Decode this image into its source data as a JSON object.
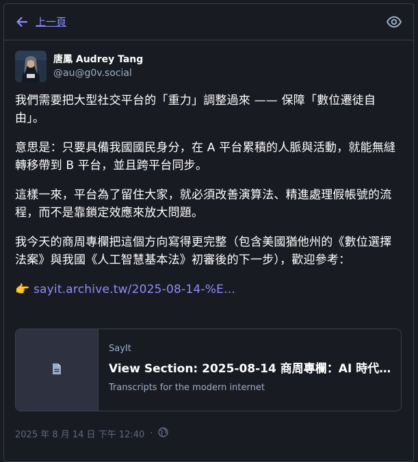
{
  "header": {
    "back_label": "上一頁",
    "back_icon": "arrow-left-icon",
    "visibility_icon": "eye-icon"
  },
  "author": {
    "display_name": "唐鳳 Audrey Tang",
    "handle": "@au@g0v.social",
    "avatar_icon": "avatar"
  },
  "post": {
    "paragraphs": [
      "我們需要把大型社交平台的「重力」調整過來 —— 保障「數位遷徒自由」。",
      "意思是：只要具備我國國民身分，在 A 平台累積的人脈與活動，就能無縫轉移帶到 B 平台，並且跨平台同步。",
      "這樣一來，平台為了留住大家，就必須改善演算法、精進處理假帳號的流程，而不是靠鎖定效應來放大問題。",
      "我今天的商周專欄把這個方向寫得更完整（包含美國猶他州的《數位選擇法案》與我國《人工智慧基本法》初審後的下一步），歡迎參考："
    ],
    "link_emoji": "👉",
    "link_text": "sayit.archive.tw/2025-08-14-%E…"
  },
  "card": {
    "provider": "SayIt",
    "title": "View Section: 2025-08-14 商周專欄：AI 時代 …",
    "description": "Transcripts for the modern internet",
    "thumb_icon": "file-icon"
  },
  "meta": {
    "timestamp": "2025 年 8 月 14 日 下午 12:40",
    "separator": "·",
    "visibility_icon": "globe-icon"
  },
  "colors": {
    "background": "#191b22",
    "border": "#393f4f",
    "accent": "#8c8dff",
    "secondary_text": "#9baec8",
    "muted_text": "#606984"
  }
}
